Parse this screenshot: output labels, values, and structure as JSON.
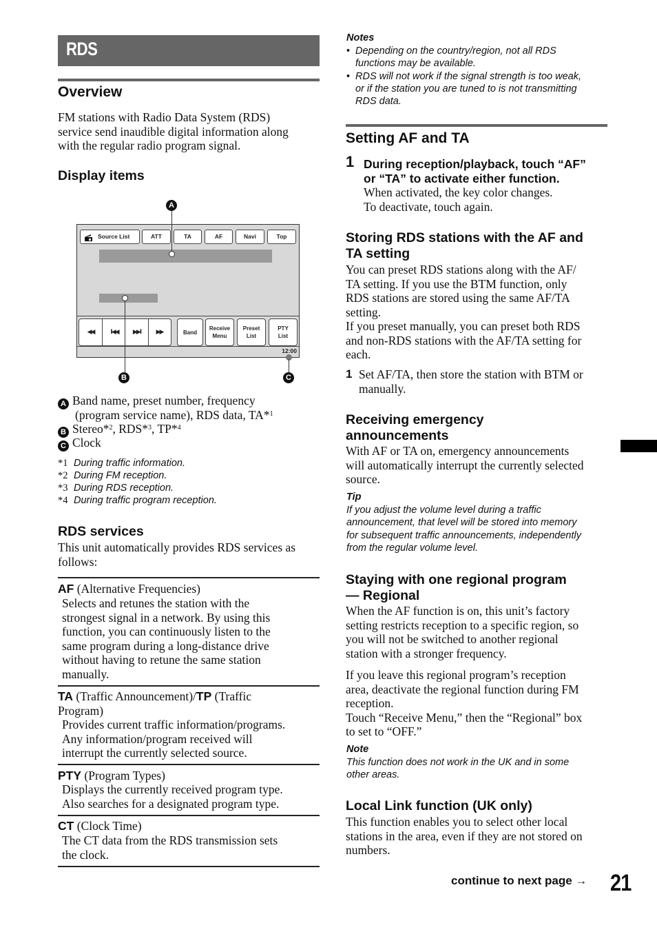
{
  "chapter": {
    "title": "RDS"
  },
  "overview": {
    "heading": "Overview",
    "lines": [
      "FM stations with Radio Data System (RDS)",
      "service send inaudible digital information along",
      "with the regular radio program signal."
    ]
  },
  "display_items": {
    "heading": "Display items",
    "diagram": {
      "top_buttons": [
        "Source List",
        "ATT",
        "TA",
        "AF",
        "Navi",
        "Top"
      ],
      "transport_icons": [
        "rewind-icon",
        "previous-track-icon",
        "next-track-icon",
        "fast-forward-icon"
      ],
      "transport_glyphs": [
        "◀◀",
        "I◀◀",
        "▶▶I",
        "▶▶"
      ],
      "bottom_buttons": [
        {
          "line1": "Band",
          "line2": ""
        },
        {
          "line1": "Receive",
          "line2": "Menu"
        },
        {
          "line1": "Preset",
          "line2": "List"
        },
        {
          "line1": "PTY",
          "line2": "List"
        }
      ],
      "clock": "12:00",
      "callouts": [
        "A",
        "B",
        "C"
      ]
    },
    "legend": [
      {
        "badge": "A",
        "line1": "Band name, preset number, frequency",
        "line2": "(program service name), RDS data, TA*",
        "sup2": "1"
      },
      {
        "badge": "B",
        "text_a": "Stereo*",
        "sup_a": "2",
        "text_b": ", RDS*",
        "sup_b": "3",
        "text_c": ", TP*",
        "sup_c": "4"
      },
      {
        "badge": "C",
        "text": "Clock"
      }
    ],
    "footnotes": [
      {
        "mark": "*1",
        "text": "During traffic information."
      },
      {
        "mark": "*2",
        "text": "During FM reception."
      },
      {
        "mark": "*3",
        "text": "During RDS reception."
      },
      {
        "mark": "*4",
        "text": "During traffic program reception."
      }
    ]
  },
  "rds_services": {
    "heading": "RDS services",
    "intro_lines": [
      "This unit automatically provides RDS services as",
      "follows:"
    ],
    "items": [
      {
        "term": "AF",
        "label": " (Alternative Frequencies)",
        "desc": [
          "Selects and retunes the station with the",
          "strongest signal in a network. By using this",
          "function, you can continuously listen to the",
          "same program during a long-distance drive",
          "without having to retune the same station",
          "manually."
        ]
      },
      {
        "term": "TA",
        "label": " (Traffic Announcement)/",
        "term2": "TP",
        "label2": " (Traffic",
        "label3": "Program)",
        "desc": [
          "Provides current traffic information/programs.",
          "Any information/program received will",
          "interrupt the currently selected source."
        ]
      },
      {
        "term": "PTY",
        "label": " (Program Types)",
        "desc": [
          "Displays the currently received program type.",
          "Also searches for a designated program type."
        ]
      },
      {
        "term": "CT",
        "label": " (Clock Time)",
        "desc": [
          "The CT data from the RDS transmission sets",
          "the clock."
        ]
      }
    ]
  },
  "notes": {
    "title": "Notes",
    "bullets": [
      {
        "line1": "Depending on the country/region, not all RDS",
        "line2": "functions may be available."
      },
      {
        "line1": "RDS will not work if the signal strength is too weak,",
        "line2": "or if the station you are tuned to is not transmitting",
        "line3": "RDS data."
      }
    ]
  },
  "setting_af_ta": {
    "heading": "Setting AF and TA",
    "step": {
      "num": "1",
      "bold_line1": "During reception/playback, touch “AF”",
      "bold_line2": "or “TA” to activate either function.",
      "line1": "When activated, the key color changes.",
      "line2": "To deactivate, touch again."
    }
  },
  "storing": {
    "heading_line1": "Storing RDS stations with the AF and",
    "heading_line2": "TA setting",
    "lines": [
      "You can preset RDS stations along with the AF/",
      "TA setting. If you use the BTM function, only",
      "RDS stations are stored using the same AF/TA",
      "setting.",
      "If you preset manually, you can preset both RDS",
      "and non-RDS stations with the AF/TA setting for",
      "each."
    ],
    "step": {
      "num": "1",
      "line1": "Set AF/TA, then store the station with BTM or",
      "line2": "manually."
    }
  },
  "emergency": {
    "heading_line1": "Receiving emergency",
    "heading_line2": "announcements",
    "lines": [
      "With AF or TA on, emergency announcements",
      "will automatically interrupt the currently selected",
      "source."
    ],
    "tip_title": "Tip",
    "tip_lines": [
      "If you adjust the volume level during a traffic",
      "announcement, that level will be stored into memory",
      "for subsequent traffic announcements, independently",
      "from the regular volume level."
    ]
  },
  "regional": {
    "heading_line1": "Staying with one regional program",
    "heading_line2": "— Regional",
    "para1": [
      "When the AF function is on, this unit’s factory",
      "setting restricts reception to a specific region, so",
      "you will not be switched to another regional",
      "station with a stronger frequency."
    ],
    "para2": [
      "If you leave this regional program’s reception",
      "area, deactivate the regional function during FM",
      "reception.",
      "Touch “Receive Menu,” then the “Regional” box",
      "to set to “OFF.”"
    ],
    "note_title": "Note",
    "note_lines": [
      "This function does not work in the UK and in some",
      "other areas."
    ]
  },
  "local_link": {
    "heading": "Local Link function (UK only)",
    "lines": [
      "This function enables you to select other local",
      "stations in the area, even if they are not stored on",
      "numbers."
    ]
  },
  "footer": {
    "continue": "continue to next page →",
    "page_number": "21"
  }
}
